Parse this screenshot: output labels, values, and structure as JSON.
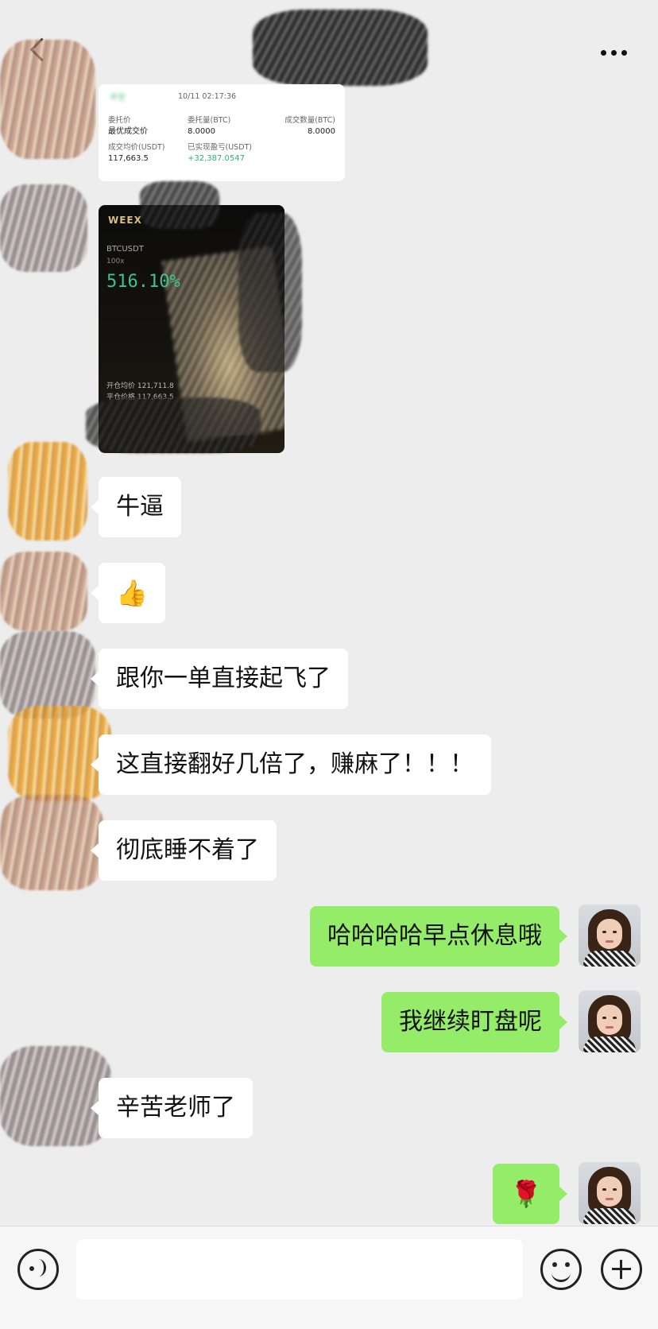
{
  "header": {
    "title": "",
    "back_icon": "chevron-left-icon",
    "more_icon": "more-dots-icon"
  },
  "trade_card": {
    "tag": "平空",
    "time": "10/11 02:17:36",
    "label_order_price": "委托价",
    "label_order_type": "最优成交价",
    "label_order_qty": "委托量(BTC)",
    "order_qty": "8.0000",
    "label_filled_qty": "成交数量(BTC)",
    "filled_qty": "8.0000",
    "label_avg_price": "成交均价(USDT)",
    "avg_price": "117,663.5",
    "label_realized_pnl": "已实现盈亏(USDT)",
    "realized_pnl": "+32,387.0547"
  },
  "share_card": {
    "logo": "WEEX",
    "pair": "BTCUSDT",
    "leverage": "100x",
    "percent": "516.10%",
    "entry_label": "开仓均价",
    "entry_price": "121,711.8",
    "close_label": "平仓价格",
    "close_price": "117,663.5"
  },
  "messages": [
    {
      "side": "left",
      "text": "牛逼"
    },
    {
      "side": "left",
      "text": "👍"
    },
    {
      "side": "left",
      "text": "跟你一单直接起飞了"
    },
    {
      "side": "left",
      "text": "这直接翻好几倍了，赚麻了！！！"
    },
    {
      "side": "left",
      "text": "彻底睡不着了"
    },
    {
      "side": "right",
      "text": "哈哈哈哈早点休息哦"
    },
    {
      "side": "right",
      "text": "我继续盯盘呢"
    },
    {
      "side": "left",
      "text": "辛苦老师了"
    },
    {
      "side": "right",
      "text": "🌹"
    }
  ],
  "input_bar": {
    "voice_icon": "voice-icon",
    "input_value": "",
    "emoji_icon": "smiley-icon",
    "plus_icon": "plus-icon"
  },
  "colors": {
    "background": "#ededed",
    "incoming_bubble": "#ffffff",
    "outgoing_bubble": "#95ec69",
    "profit_green": "#3fc28d"
  }
}
